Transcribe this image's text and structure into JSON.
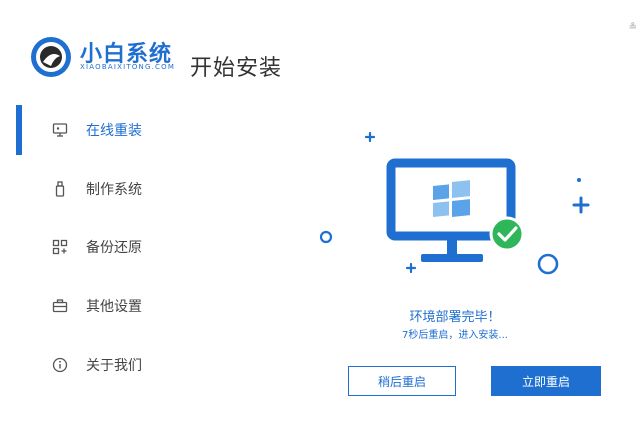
{
  "header": {
    "brand_title": "小白系统",
    "brand_subtitle": "XIAOBAIXITONG.COM",
    "page_title": "开始安装",
    "corner_glyph": "≗"
  },
  "sidebar": {
    "items": [
      {
        "label": "在线重装",
        "icon": "monitor-icon",
        "active": true
      },
      {
        "label": "制作系统",
        "icon": "usb-drive-icon",
        "active": false
      },
      {
        "label": "备份还原",
        "icon": "grid-icon",
        "active": false
      },
      {
        "label": "其他设置",
        "icon": "briefcase-icon",
        "active": false
      },
      {
        "label": "关于我们",
        "icon": "info-icon",
        "active": false
      }
    ]
  },
  "status": {
    "title": "环境部署完毕！",
    "countdown": "7秒后重启，进入安装..."
  },
  "buttons": {
    "later": "稍后重启",
    "now": "立即重启"
  },
  "colors": {
    "accent": "#1f6fd1",
    "success": "#2fb55a"
  }
}
